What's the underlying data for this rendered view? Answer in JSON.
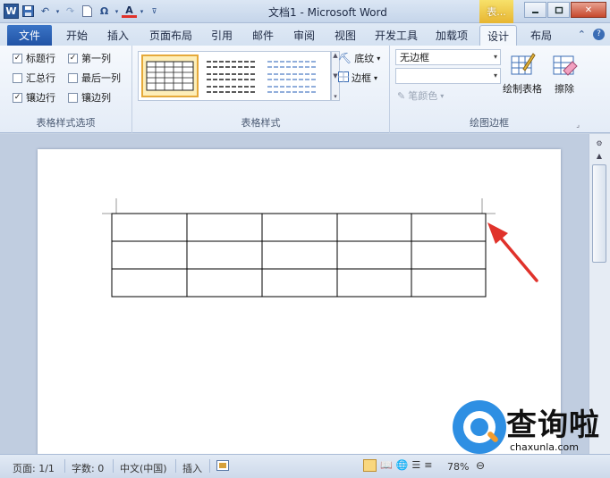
{
  "window": {
    "title": "文档1 - Microsoft Word",
    "context_tab": "表...",
    "qat": {
      "app_icon": "W"
    }
  },
  "tabs": [
    {
      "label": "文件"
    },
    {
      "label": "开始"
    },
    {
      "label": "插入"
    },
    {
      "label": "页面布局"
    },
    {
      "label": "引用"
    },
    {
      "label": "邮件"
    },
    {
      "label": "审阅"
    },
    {
      "label": "视图"
    },
    {
      "label": "开发工具"
    },
    {
      "label": "加载项"
    },
    {
      "label": "设计"
    },
    {
      "label": "布局"
    }
  ],
  "ribbon": {
    "style_options": {
      "label": "表格样式选项",
      "items": [
        {
          "label": "标题行",
          "checked": true
        },
        {
          "label": "第一列",
          "checked": true
        },
        {
          "label": "汇总行",
          "checked": false
        },
        {
          "label": "最后一列",
          "checked": false
        },
        {
          "label": "镶边行",
          "checked": true
        },
        {
          "label": "镶边列",
          "checked": false
        }
      ]
    },
    "table_styles": {
      "label": "表格样式",
      "shading": "底纹",
      "borders": "边框"
    },
    "draw_borders": {
      "label": "绘图边框",
      "border_style": "无边框",
      "pen_color": "笔颜色",
      "draw_table": "绘制表格",
      "eraser": "擦除"
    }
  },
  "document": {
    "table": {
      "rows": 3,
      "cols": 5
    }
  },
  "status": {
    "page": "页面: 1/1",
    "words": "字数: 0",
    "language": "中文(中国)",
    "mode": "插入",
    "zoom": "78%"
  },
  "watermark": {
    "title": "查询啦",
    "url": "chaxunla.com"
  },
  "colors": {
    "accent": "#2b579a",
    "arrow": "#e0322b",
    "context_tab": "#e7b531"
  }
}
